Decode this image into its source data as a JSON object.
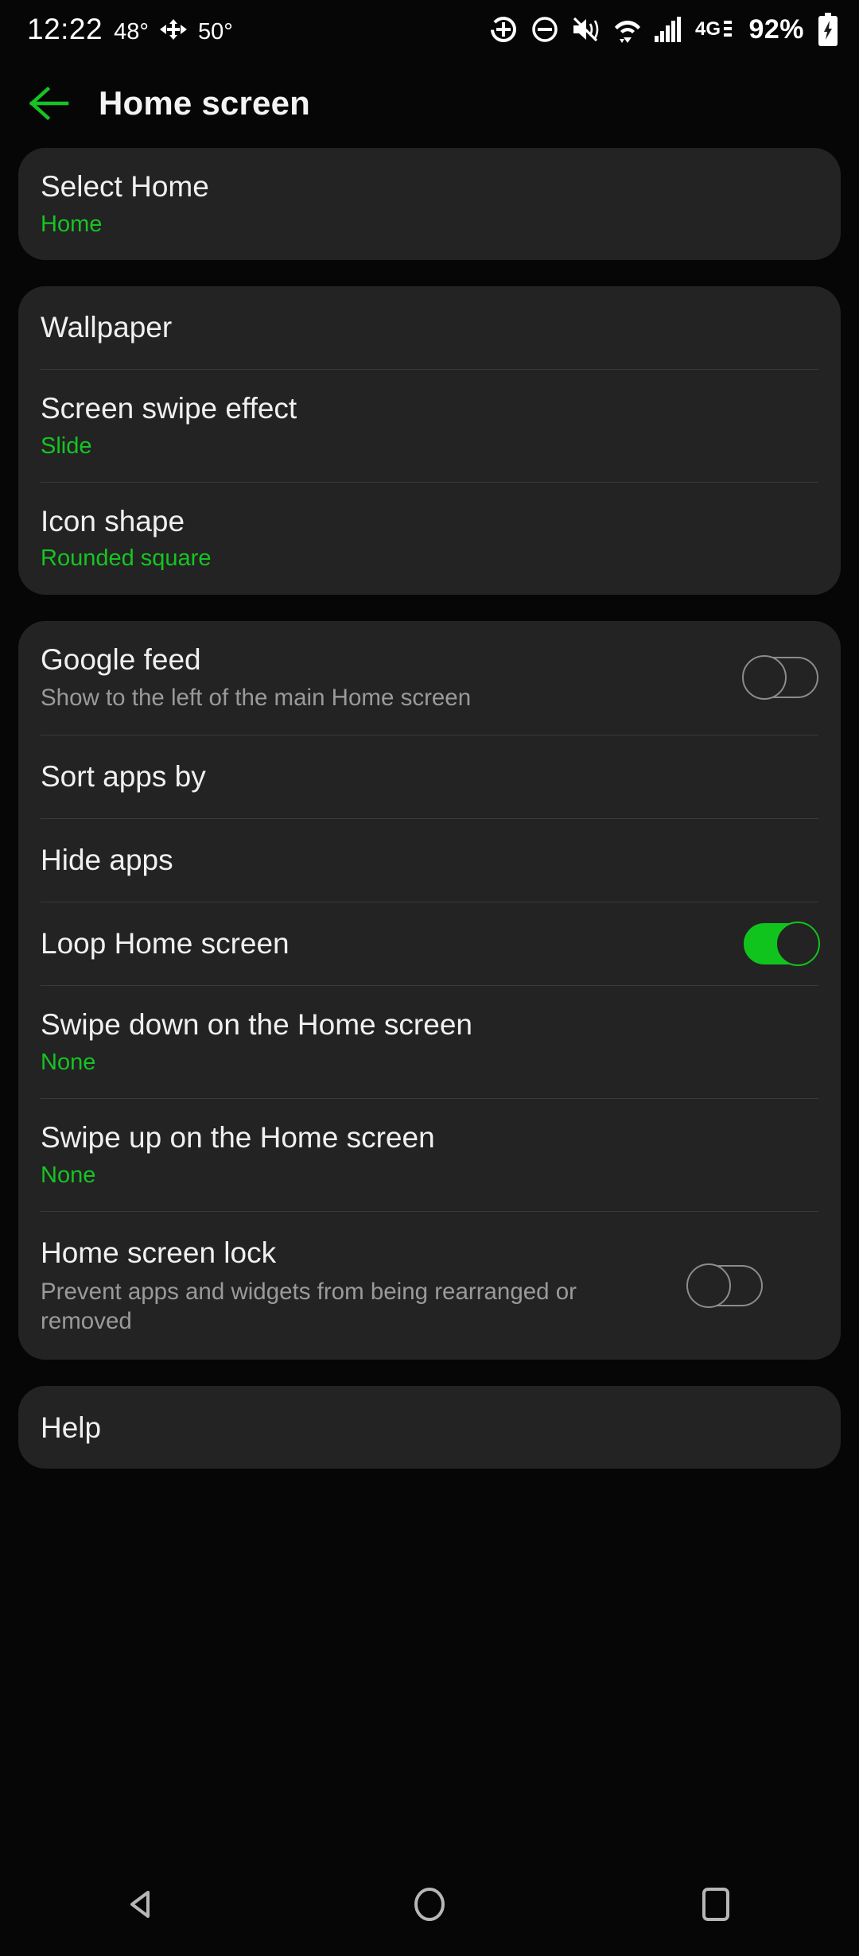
{
  "status_bar": {
    "clock": "12:22",
    "temp_primary": "48°",
    "temp_secondary": "50°",
    "battery_percent": "92%",
    "icons": [
      "location-crosshair-icon",
      "do-not-disturb-icon",
      "mute-vibrate-icon",
      "wifi-icon",
      "cellular-signal-icon",
      "network-4g-lte-icon",
      "battery-charging-icon"
    ]
  },
  "header": {
    "back_icon": "back-arrow-icon",
    "title": "Home screen"
  },
  "accent_green": "#16c423",
  "toggle_on_color": "#11c41d",
  "cards": [
    {
      "rows": [
        {
          "title": "Select Home",
          "sub": "Home",
          "sub_style": "accent",
          "control": "none"
        }
      ]
    },
    {
      "rows": [
        {
          "title": "Wallpaper",
          "sub": "",
          "sub_style": "none",
          "control": "none"
        },
        {
          "title": "Screen swipe effect",
          "sub": "Slide",
          "sub_style": "accent",
          "control": "none"
        },
        {
          "title": "Icon shape",
          "sub": "Rounded square",
          "sub_style": "accent",
          "control": "none"
        }
      ]
    },
    {
      "rows": [
        {
          "title": "Google feed",
          "sub": "Show to the left of the main Home screen",
          "sub_style": "grey",
          "control": "toggle",
          "toggle_state": "off"
        },
        {
          "title": "Sort apps by",
          "sub": "",
          "sub_style": "none",
          "control": "none"
        },
        {
          "title": "Hide apps",
          "sub": "",
          "sub_style": "none",
          "control": "none"
        },
        {
          "title": "Loop Home screen",
          "sub": "",
          "sub_style": "none",
          "control": "toggle",
          "toggle_state": "on"
        },
        {
          "title": "Swipe down on the Home screen",
          "sub": "None",
          "sub_style": "accent",
          "control": "none"
        },
        {
          "title": "Swipe up on the Home screen",
          "sub": "None",
          "sub_style": "accent",
          "control": "none"
        },
        {
          "title": "Home screen lock",
          "sub": "Prevent apps and widgets from being rearranged or removed",
          "sub_style": "grey",
          "control": "toggle",
          "toggle_state": "off"
        }
      ]
    },
    {
      "rows": [
        {
          "title": "Help",
          "sub": "",
          "sub_style": "none",
          "control": "none"
        }
      ]
    }
  ],
  "nav_bar": {
    "back": "nav-back-icon",
    "home": "nav-home-icon",
    "recents": "nav-recents-icon"
  }
}
